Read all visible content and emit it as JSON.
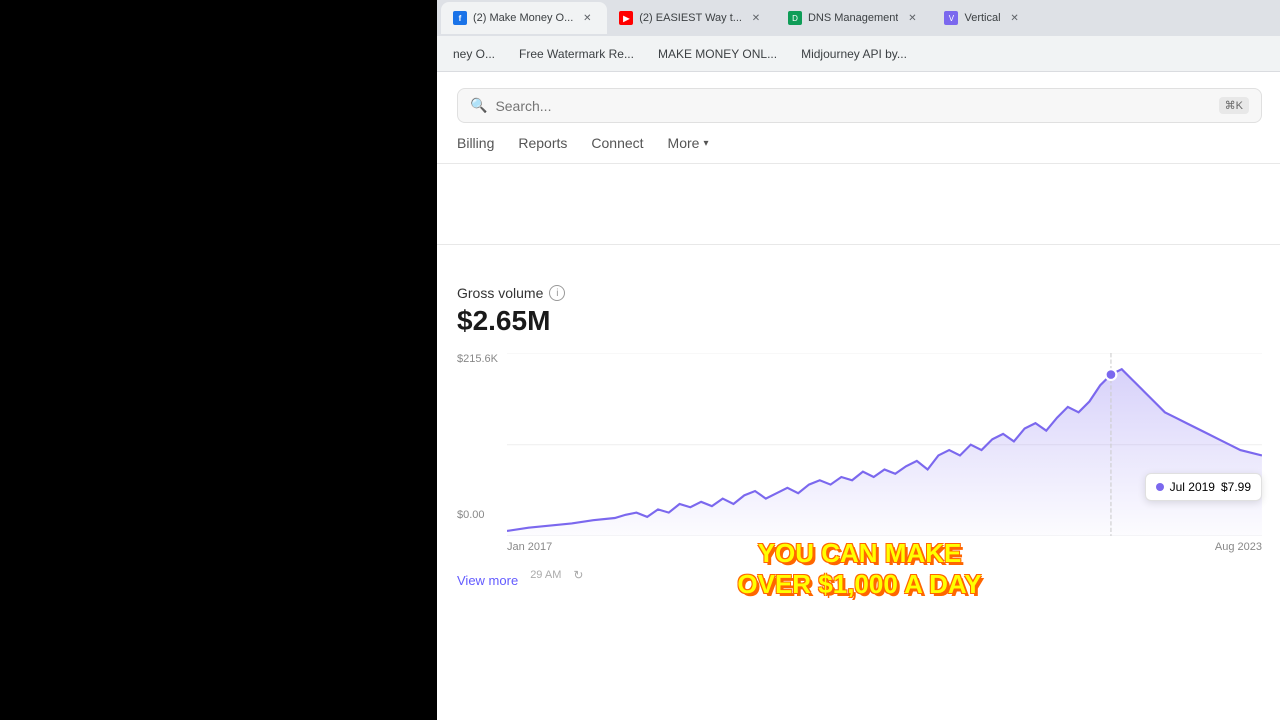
{
  "browser": {
    "tabs": [
      {
        "id": "tab-1",
        "favicon_color": "blue",
        "favicon_text": "f",
        "title": "(2) Make Money O...",
        "active": true
      },
      {
        "id": "tab-2",
        "favicon_color": "red",
        "favicon_text": "▶",
        "title": "(2) EASIEST Way t...",
        "active": false
      },
      {
        "id": "tab-3",
        "favicon_color": "green",
        "favicon_text": "D",
        "title": "DNS Management",
        "active": false
      },
      {
        "id": "tab-4",
        "favicon_color": "purple",
        "favicon_text": "V",
        "title": "Vertical",
        "active": false
      }
    ],
    "bookmarks": [
      {
        "id": "bm-1",
        "text": "ney O..."
      },
      {
        "id": "bm-2",
        "text": "Free Watermark Re..."
      },
      {
        "id": "bm-3",
        "text": "MAKE MONEY ONL..."
      },
      {
        "id": "bm-4",
        "text": "Midjourney API by..."
      }
    ]
  },
  "search": {
    "placeholder": "Search...",
    "shortcut": "⌘K"
  },
  "nav": {
    "items": [
      {
        "id": "billing",
        "label": "Billing"
      },
      {
        "id": "reports",
        "label": "Reports"
      },
      {
        "id": "connect",
        "label": "Connect"
      },
      {
        "id": "more",
        "label": "More"
      }
    ]
  },
  "gross_volume": {
    "title": "Gross volume",
    "amount": "$2.65M",
    "y_max_label": "$215.6K",
    "y_min_label": "$0.00",
    "x_labels": [
      "Jan 2017",
      "Aug 2023"
    ],
    "tooltip": {
      "date": "Jul 2019",
      "value": "$7.99"
    }
  },
  "view_more": {
    "label": "View more"
  },
  "overlay": {
    "line1": "YOU CAN MAKE",
    "line2": "OVER $1,000 A DAY"
  },
  "timestamp": {
    "text": "29 AM"
  }
}
